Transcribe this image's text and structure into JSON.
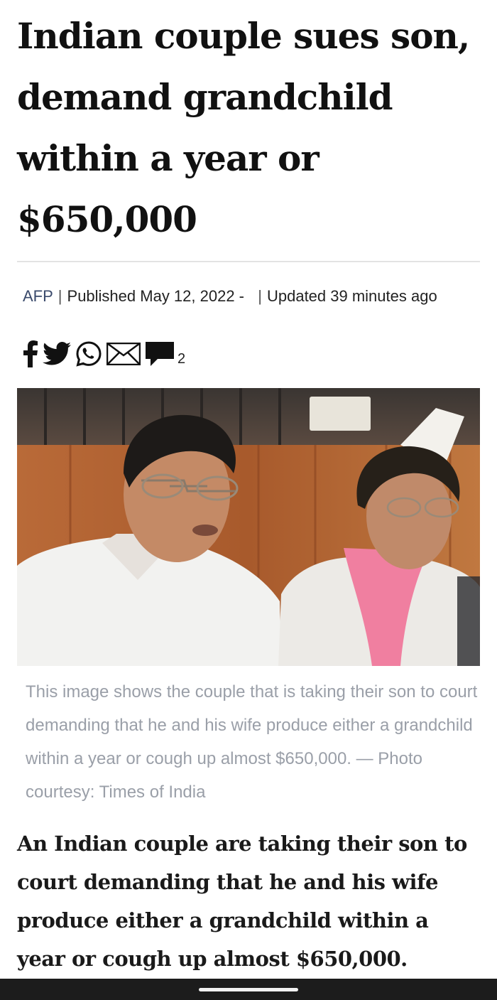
{
  "article": {
    "headline": "Indian couple sues son, demand grandchild within a year or $650,000",
    "meta": {
      "source": "AFP",
      "published": "Published May 12, 2022 -",
      "updated": "Updated 39 minutes ago"
    },
    "share": {
      "icons": [
        "facebook-icon",
        "twitter-icon",
        "whatsapp-icon",
        "email-icon",
        "comment-icon"
      ],
      "comment_count": "2"
    },
    "photo": {
      "caption": "This image shows the couple that is taking their son to court demanding that he and his wife produce either a grandchild within a year or cough up almost $650,000. — Photo courtesy: Times of India"
    },
    "lead": "An Indian couple are taking their son to court demanding that he and his wife produce either a grandchild within a year or cough up almost $650,000."
  },
  "colors": {
    "headline": "#111111",
    "caption": "#9a9fa8",
    "navbar": "#1c1c1c"
  }
}
